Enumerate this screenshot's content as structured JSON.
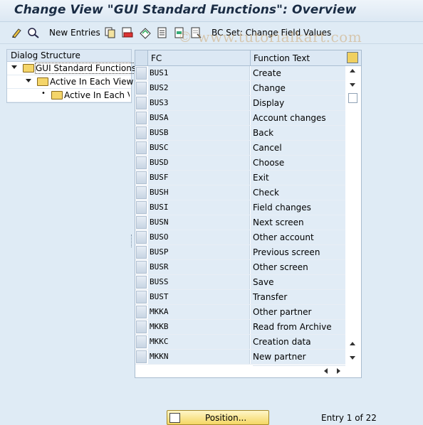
{
  "window": {
    "title": "Change View \"GUI Standard Functions\": Overview"
  },
  "toolbar": {
    "new_entries": "New Entries",
    "bc_set": "BC Set: Change Field Values"
  },
  "watermark": "© www.tutorialkart.com",
  "tree": {
    "header": "Dialog Structure",
    "items": [
      {
        "label": "GUI Standard Functions"
      },
      {
        "label": "Active In Each View"
      },
      {
        "label": "Active In Each Vi"
      }
    ]
  },
  "table": {
    "columns": {
      "fc": "FC",
      "text": "Function Text"
    },
    "rows": [
      {
        "fc": "BUS1",
        "text": "Create"
      },
      {
        "fc": "BUS2",
        "text": "Change"
      },
      {
        "fc": "BUS3",
        "text": "Display"
      },
      {
        "fc": "BUSA",
        "text": "Account changes"
      },
      {
        "fc": "BUSB",
        "text": "Back"
      },
      {
        "fc": "BUSC",
        "text": "Cancel"
      },
      {
        "fc": "BUSD",
        "text": "Choose"
      },
      {
        "fc": "BUSF",
        "text": "Exit"
      },
      {
        "fc": "BUSH",
        "text": "Check"
      },
      {
        "fc": "BUSI",
        "text": "Field changes"
      },
      {
        "fc": "BUSN",
        "text": "Next screen"
      },
      {
        "fc": "BUSO",
        "text": "Other account"
      },
      {
        "fc": "BUSP",
        "text": "Previous screen"
      },
      {
        "fc": "BUSR",
        "text": "Other screen"
      },
      {
        "fc": "BUSS",
        "text": "Save"
      },
      {
        "fc": "BUST",
        "text": "Transfer"
      },
      {
        "fc": "MKKA",
        "text": "Other partner"
      },
      {
        "fc": "MKKB",
        "text": "Read from Archive"
      },
      {
        "fc": "MKKC",
        "text": "Creation data"
      },
      {
        "fc": "MKKN",
        "text": "New partner"
      }
    ]
  },
  "footer": {
    "position_button": "Position...",
    "entry_info": "Entry 1 of 22"
  }
}
